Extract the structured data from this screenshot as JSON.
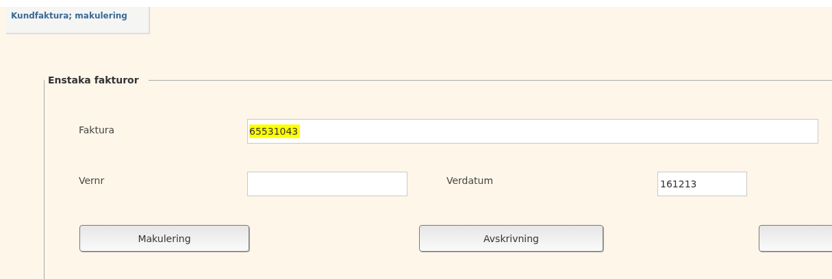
{
  "tab": {
    "label": "Kundfaktura; makulering",
    "selected": true
  },
  "group": {
    "legend": "Enstaka fakturor",
    "fields": [
      {
        "label": "Faktura",
        "value": "65531043",
        "highlighted": true
      },
      {
        "label": "Vernr"
      },
      {
        "label": "Verdatum",
        "value": "161213",
        "highlighted": false
      }
    ],
    "buttons": [
      {
        "kind": "labelled",
        "label": "Makulering"
      },
      {
        "kind": "labelled",
        "label": "Avskrivning"
      },
      {
        "kind": "blank"
      }
    ]
  }
}
